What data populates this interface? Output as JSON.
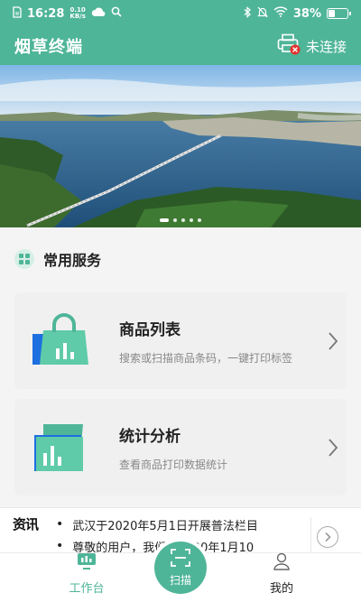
{
  "status_bar": {
    "time": "16:28",
    "net_speed_value": "0.10",
    "net_speed_unit": "KB/s",
    "battery_percent": "38%",
    "battery_level": 0.38
  },
  "header": {
    "title": "烟草终端",
    "connection_status": "未连接"
  },
  "banner": {
    "slide_count": 5,
    "active_slide": 0
  },
  "services": {
    "section_title": "常用服务",
    "cards": [
      {
        "title": "商品列表",
        "description": "搜索或扫描商品条码，一键打印标签"
      },
      {
        "title": "统计分析",
        "description": "查看商品打印数据统计"
      }
    ]
  },
  "news": {
    "logo_text": "资讯",
    "items": [
      "武汉于2020年5月1日开展普法栏目",
      "尊敬的用户，我们于2020年1月10"
    ]
  },
  "tabbar": {
    "work_label": "工作台",
    "scan_label": "扫描",
    "mine_label": "我的"
  },
  "colors": {
    "primary": "#4fb598",
    "accent_blue": "#1e6fe0",
    "text_dark": "#222222",
    "text_muted": "#888888"
  }
}
